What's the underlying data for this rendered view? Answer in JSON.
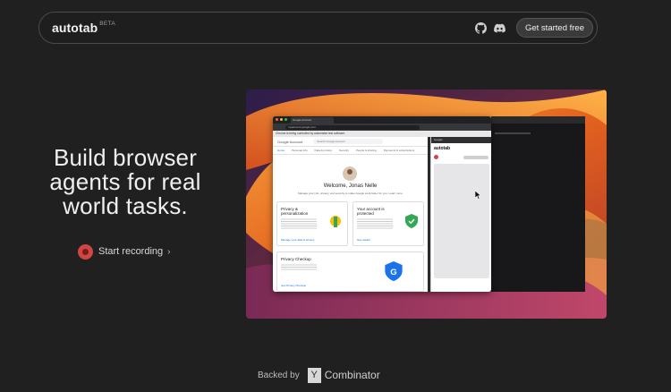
{
  "nav": {
    "brand": "autotab",
    "badge": "BETA",
    "github_icon": "github-icon",
    "discord_icon": "discord-icon",
    "cta_label": "Get started free"
  },
  "hero": {
    "title_lines": [
      "Build browser",
      "agents for real",
      "world tasks."
    ],
    "record_label": "Start recording",
    "record_chevron": "›"
  },
  "demo": {
    "tab_title": "Google Account",
    "url": "myaccount.google.com",
    "infobar": "Chrome is being controlled by automated test software.",
    "page_header": "Google Account",
    "search_placeholder": "Search Google Account",
    "tabs": [
      "Home",
      "Personal info",
      "Data & privacy",
      "Security",
      "People & sharing",
      "Payments & subscriptions"
    ],
    "welcome": "Welcome, Jonas Nelle",
    "welcome_sub": "Manage your info, privacy, and security to make Google work better for you. Learn more",
    "cards": [
      {
        "title": "Privacy & personalization",
        "link": "Manage your data & privacy"
      },
      {
        "title": "Your account is protected",
        "link": "See details"
      },
      {
        "title": "Privacy Checkup",
        "link": "Get Privacy Checkup"
      }
    ],
    "panel_tab": "Google",
    "panel_brand": "autotab"
  },
  "footer": {
    "backed_by": "Backed by",
    "yc_letter": "Y",
    "yc_name": "Combinator"
  },
  "colors": {
    "background": "#202020",
    "record_red": "#d14545",
    "cta_bg": "#3a3a3a"
  }
}
